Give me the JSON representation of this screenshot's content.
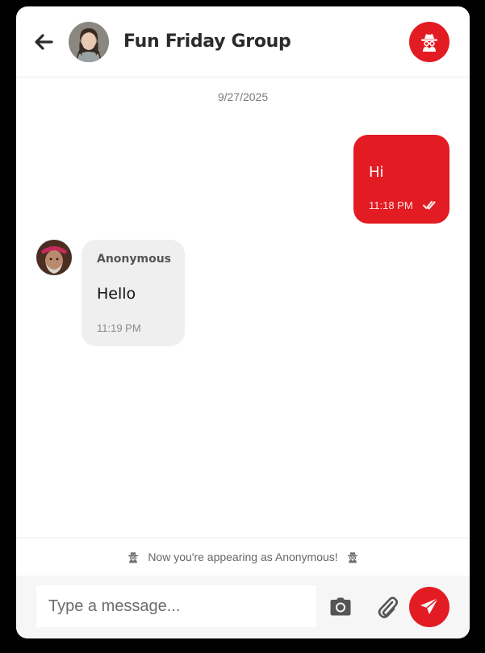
{
  "header": {
    "back_icon": "arrow-left-icon",
    "title": "Fun Friday Group",
    "group_avatar": "avatar",
    "incognito_icon": "incognito-icon",
    "accent_color": "#e31b23"
  },
  "messages": {
    "date": "9/27/2025",
    "outgoing": {
      "text": "Hi",
      "time": "11:18 PM",
      "status_icon": "double-check-icon"
    },
    "incoming": {
      "sender": "Anonymous",
      "text": "Hello",
      "time": "11:19 PM"
    }
  },
  "notice": {
    "text": "Now you're appearing as Anonymous!",
    "icon": "incognito-icon"
  },
  "composer": {
    "placeholder": "Type a message...",
    "camera_icon": "camera-icon",
    "attach_icon": "paperclip-icon",
    "send_icon": "send-icon"
  },
  "colors": {
    "accent": "#e31b23",
    "incoming_bubble": "#efefef",
    "composer_bg": "#f6f6f6"
  }
}
